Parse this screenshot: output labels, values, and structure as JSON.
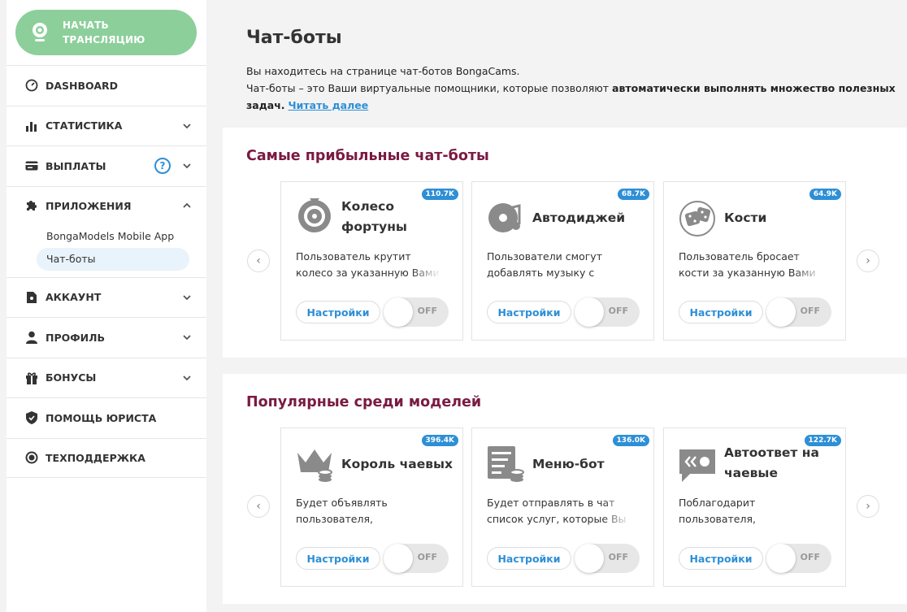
{
  "sidebar": {
    "start_button": "НАЧАТЬ ТРАНСЛЯЦИЮ",
    "items": [
      {
        "label": "DASHBOARD"
      },
      {
        "label": "СТАТИСТИКА"
      },
      {
        "label": "ВЫПЛАТЫ",
        "help": "?"
      },
      {
        "label": "ПРИЛОЖЕНИЯ"
      },
      {
        "label": "АККАУНТ"
      },
      {
        "label": "ПРОФИЛЬ"
      },
      {
        "label": "БОНУСЫ"
      },
      {
        "label": "ПОМОЩЬ ЮРИСТА"
      },
      {
        "label": "ТЕХПОДДЕРЖКА"
      }
    ],
    "apps_sub": [
      {
        "label": "BongaModels Mobile App"
      },
      {
        "label": "Чат-боты"
      }
    ]
  },
  "main": {
    "title": "Чат-боты",
    "intro_line1": "Вы находитесь на странице чат-ботов BongaCams.",
    "intro_line2_a": "Чат-боты – это Ваши виртуальные помощники, которые позволяют ",
    "intro_line2_b": "автоматически выполнять множество полезных задач.",
    "read_more": "Читать далее",
    "sections": [
      {
        "title": "Самые прибыльные чат-боты",
        "cards": [
          {
            "badge": "110.7K",
            "title": "Колесо фортуны",
            "desc": "Пользователь крутит колесо за указанную Вами сумму токенов",
            "settings": "Настройки",
            "state": "OFF",
            "icon": "wheel-icon"
          },
          {
            "badge": "68.7K",
            "title": "Автодиджей",
            "desc": "Пользователи смогут добавлять музыку с YouTube",
            "settings": "Настройки",
            "state": "OFF",
            "icon": "music-icon"
          },
          {
            "badge": "64.9K",
            "title": "Кости",
            "desc": "Пользователь бросает кости за указанную Вами сумму",
            "settings": "Настройки",
            "state": "OFF",
            "icon": "dice-icon"
          }
        ]
      },
      {
        "title": "Популярные среди моделей",
        "cards": [
          {
            "badge": "396.4K",
            "title": "Король чаевых",
            "desc": "Будет объявлять пользователя, подарившего больше всех",
            "settings": "Настройки",
            "state": "OFF",
            "icon": "crown-icon"
          },
          {
            "badge": "136.0K",
            "title": "Меню-бот",
            "desc": "Будет отправлять в чат список услуг, которые Вы предлагаете",
            "settings": "Настройки",
            "state": "OFF",
            "icon": "menu-icon"
          },
          {
            "badge": "122.7K",
            "title": "Автоответ на чаевые",
            "desc": "Поблагодарит пользователя, подарившего токены",
            "settings": "Настройки",
            "state": "OFF",
            "icon": "quote-icon"
          }
        ]
      }
    ]
  },
  "colors": {
    "green": "#8ccf9a",
    "accent": "#2e8fd6",
    "section_title": "#7a1a43"
  }
}
